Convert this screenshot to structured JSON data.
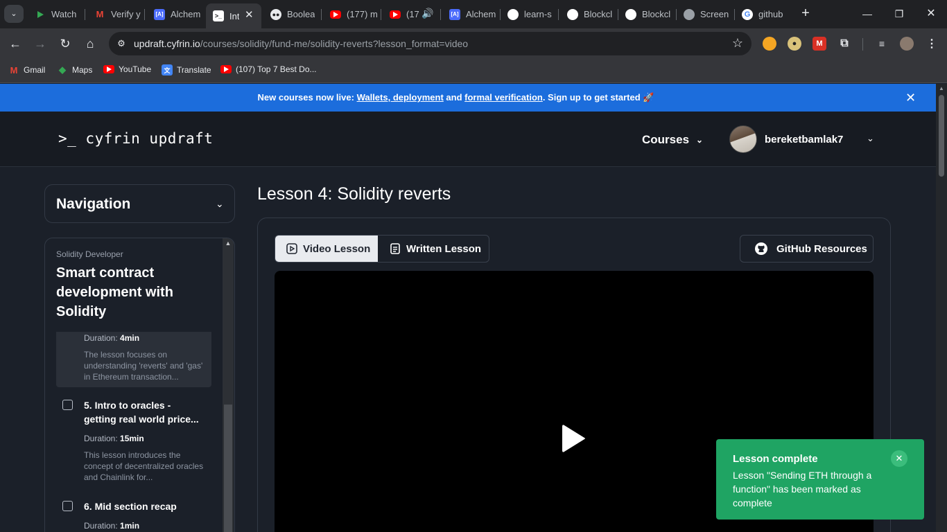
{
  "browser": {
    "tabs": [
      {
        "title": "Watch",
        "icon": "play-icon",
        "color": "#34a853"
      },
      {
        "title": "Verify y",
        "icon": "gmail-icon",
        "color": "#ea4335"
      },
      {
        "title": "Alchem",
        "icon": "alchemy-icon",
        "color": "#4b6bfb"
      },
      {
        "title": "Int",
        "icon": "cyfrin-icon",
        "color": "#ffffff"
      },
      {
        "title": "Boolea",
        "icon": "bot-icon",
        "color": "#ffffff"
      },
      {
        "title": "(177) m",
        "icon": "youtube-icon",
        "color": "#ff0000"
      },
      {
        "title": "(17",
        "icon": "youtube-icon",
        "color": "#ff0000"
      },
      {
        "title": "Alchem",
        "icon": "alchemy-icon",
        "color": "#4b6bfb"
      },
      {
        "title": "learn-s",
        "icon": "github-icon",
        "color": "#ffffff"
      },
      {
        "title": "Blockcl",
        "icon": "github-icon",
        "color": "#ffffff"
      },
      {
        "title": "Blockcl",
        "icon": "github-icon",
        "color": "#ffffff"
      },
      {
        "title": "Screen",
        "icon": "globe-icon",
        "color": "#9aa0a6"
      },
      {
        "title": "github",
        "icon": "google-icon",
        "color": "#4285f4"
      }
    ],
    "active_tab_index": 3,
    "url_domain": "updraft.cyfrin.io",
    "url_path": "/courses/solidity/fund-me/solidity-reverts?lesson_format=video",
    "bookmarks": [
      {
        "label": "Gmail",
        "icon": "gmail-icon"
      },
      {
        "label": "Maps",
        "icon": "maps-icon"
      },
      {
        "label": "YouTube",
        "icon": "youtube-icon"
      },
      {
        "label": "Translate",
        "icon": "translate-icon"
      },
      {
        "label": "(107) Top 7 Best Do...",
        "icon": "youtube-icon"
      }
    ]
  },
  "banner": {
    "prefix": "New courses now live: ",
    "link1": "Wallets, deployment",
    "middle": " and ",
    "link2": "formal verification",
    "suffix": ". Sign up to get started 🚀"
  },
  "header": {
    "logo": ">_ cyfrin updraft",
    "courses_label": "Courses",
    "username": "bereketbamlak7"
  },
  "sidebar": {
    "nav_title": "Navigation",
    "course_subtitle": "Solidity Developer",
    "course_title": "Smart contract development with Solidity",
    "current_item": {
      "duration_label": "Duration: ",
      "duration_value": "4min",
      "description": "The lesson focuses on understanding 'reverts' and 'gas' in Ethereum transaction..."
    },
    "items": [
      {
        "title": "5. Intro to oracles - getting real world price...",
        "duration_label": "Duration: ",
        "duration_value": "15min",
        "description": "This lesson introduces the concept of decentralized oracles and Chainlink for..."
      },
      {
        "title": "6. Mid section recap",
        "duration_label": "Duration: ",
        "duration_value": "1min"
      }
    ]
  },
  "lesson": {
    "heading": "Lesson 4: Solidity reverts",
    "video_tab": "Video Lesson",
    "written_tab": "Written Lesson",
    "github_button": "GitHub Resources"
  },
  "toast": {
    "title": "Lesson complete",
    "body": "Lesson \"Sending ETH through a function\" has been marked as complete"
  },
  "colors": {
    "banner": "#1c6ddc",
    "page_bg": "#1b2029",
    "toast": "#1fa463"
  }
}
